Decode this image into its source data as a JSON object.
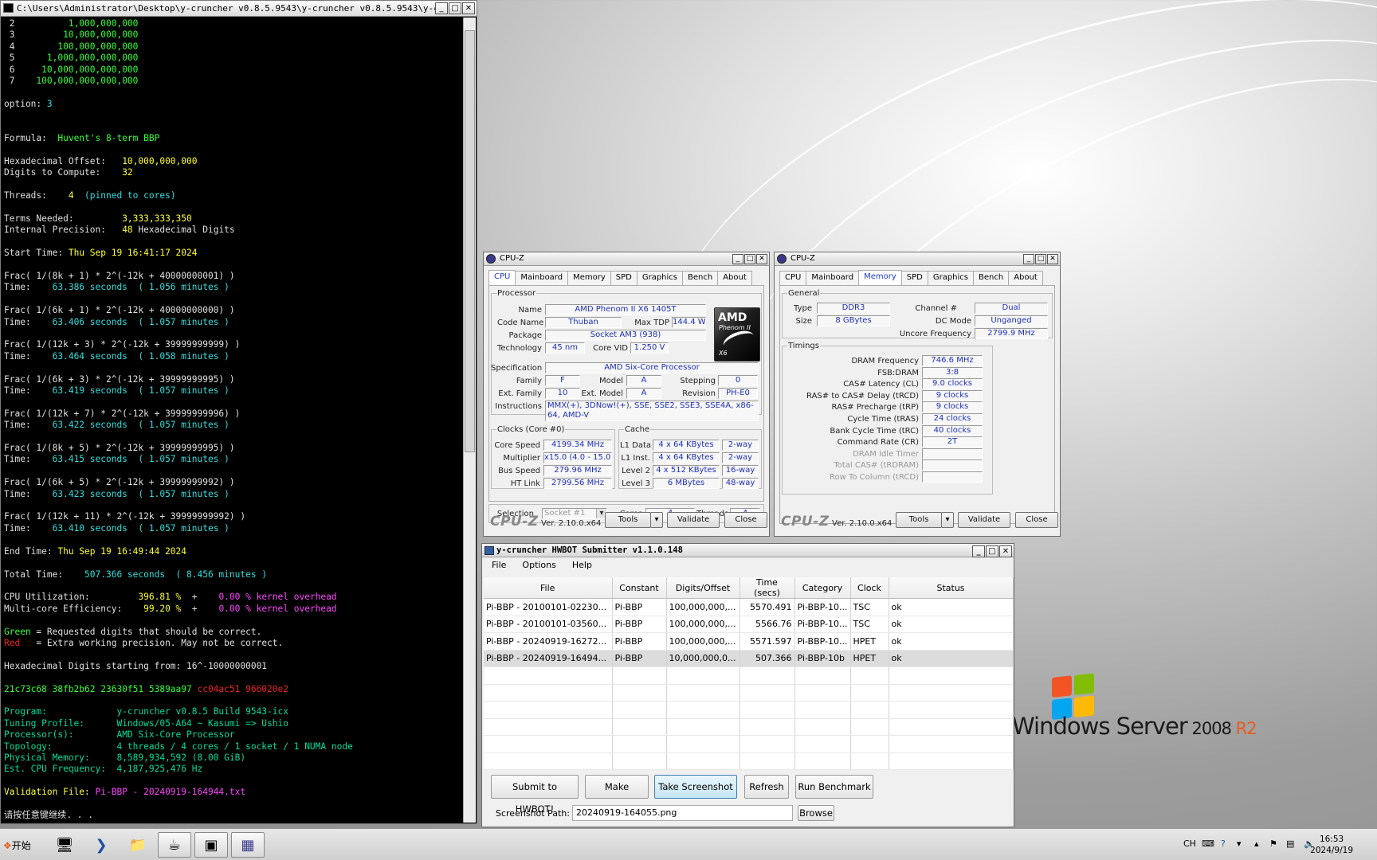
{
  "console": {
    "title": "C:\\Users\\Administrator\\Desktop\\y-cruncher v0.8.5.9543\\y-cruncher v0.8.5.9543\\y-c...",
    "options": [
      {
        "n": "2",
        "v": "1,000,000,000"
      },
      {
        "n": "3",
        "v": "10,000,000,000"
      },
      {
        "n": "4",
        "v": "100,000,000,000"
      },
      {
        "n": "5",
        "v": "1,000,000,000,000"
      },
      {
        "n": "6",
        "v": "10,000,000,000,000"
      },
      {
        "n": "7",
        "v": "100,000,000,000,000"
      }
    ],
    "option_label": "option: ",
    "option_value": "3",
    "formula_label": "Formula:  ",
    "formula_value": "Huvent's 8-term BBP",
    "hex_offset_label": "Hexadecimal Offset:   ",
    "hex_offset_value": "10,000,000,000",
    "digits_label": "Digits to Compute:    ",
    "digits_value": "32",
    "threads_label": "Threads:    ",
    "threads_value": "4",
    "threads_note": "  (pinned to cores)",
    "terms_label": "Terms Needed:         ",
    "terms_value": "3,333,333,350",
    "precision_label": "Internal Precision:   ",
    "precision_value": "48",
    "precision_unit": " Hexadecimal Digits",
    "start_label": "Start Time: ",
    "start_value": "Thu Sep 19 16:41:17 2024",
    "fracs": [
      {
        "f": "Frac( 1/(8k + 1) * 2^(-12k + 40000000001) )",
        "t": "63.386 seconds  ( 1.056 minutes )"
      },
      {
        "f": "Frac( 1/(6k + 1) * 2^(-12k + 40000000000) )",
        "t": "63.406 seconds  ( 1.057 minutes )"
      },
      {
        "f": "Frac( 1/(12k + 3) * 2^(-12k + 39999999999) )",
        "t": "63.464 seconds  ( 1.058 minutes )"
      },
      {
        "f": "Frac( 1/(6k + 3) * 2^(-12k + 39999999995) )",
        "t": "63.419 seconds  ( 1.057 minutes )"
      },
      {
        "f": "Frac( 1/(12k + 7) * 2^(-12k + 39999999996) )",
        "t": "63.422 seconds  ( 1.057 minutes )"
      },
      {
        "f": "Frac( 1/(8k + 5) * 2^(-12k + 39999999995) )",
        "t": "63.415 seconds  ( 1.057 minutes )"
      },
      {
        "f": "Frac( 1/(6k + 5) * 2^(-12k + 39999999992) )",
        "t": "63.423 seconds  ( 1.057 minutes )"
      },
      {
        "f": "Frac( 1/(12k + 11) * 2^(-12k + 39999999992) )",
        "t": "63.410 seconds  ( 1.057 minutes )"
      }
    ],
    "time_label": "Time:    ",
    "end_label": "End Time: ",
    "end_value": "Thu Sep 19 16:49:44 2024",
    "total_label": "Total Time:    ",
    "total_value": "507.366 seconds  ( 8.456 minutes )",
    "cpu_util_label": "CPU Utilization:         ",
    "cpu_util_value": "396.81 %",
    "cpu_util_kernel": "0.00 % kernel overhead",
    "multicore_label": "Multi-core Efficiency:    ",
    "multicore_value": "99.20 %",
    "multicore_kernel": "0.00 % kernel overhead",
    "plus": "  +    ",
    "legend_green": "Green",
    "legend_green_text": " = Requested digits that should be correct.",
    "legend_red": "Red",
    "legend_red_text": "   = Extra working precision. May not be correct.",
    "hex_start": "Hexadecimal Digits starting from: 16^-10000000001",
    "digits_green": "21c73c68 38fb2b62 23630f51 5389aa97",
    "digits_red": " cc04ac51 966020e2",
    "program_label": "Program:             ",
    "program_value": "y-cruncher v0.8.5 Build 9543-icx",
    "tuning_label": "Tuning Profile:      ",
    "tuning_value": "Windows/05-A64 ~ Kasumi => Ushio",
    "processor_label": "Processor(s):        ",
    "processor_value": "AMD Six-Core Processor",
    "topology_label": "Topology:            ",
    "topology_value": "4 threads / 4 cores / 1 socket / 1 NUMA node",
    "memory_label": "Physical Memory:     ",
    "memory_value": "8,589,934,592 (8.00 GiB)",
    "freq_label": "Est. CPU Frequency:  ",
    "freq_value": "4,187,925,476 Hz",
    "validation_label": "Validation File: ",
    "validation_value": "Pi-BBP - 20240919-164944.txt",
    "press_key": "请按任意键继续. . ."
  },
  "cpuz_cpu": {
    "title": "CPU-Z",
    "tabs": [
      "CPU",
      "Mainboard",
      "Memory",
      "SPD",
      "Graphics",
      "Bench",
      "About"
    ],
    "active_tab": "CPU",
    "processor_group": "Processor",
    "name_label": "Name",
    "name": "AMD Phenom II X6 1405T",
    "codename_label": "Code Name",
    "codename": "Thuban",
    "maxtdp_label": "Max TDP",
    "maxtdp": "144.4 W",
    "package_label": "Package",
    "package": "Socket AM3 (938)",
    "tech_label": "Technology",
    "tech": "45 nm",
    "corevid_label": "Core VID",
    "corevid": "1.250 V",
    "spec_label": "Specification",
    "spec": "AMD Six-Core Processor",
    "family_label": "Family",
    "family": "F",
    "model_label": "Model",
    "model": "A",
    "stepping_label": "Stepping",
    "stepping": "0",
    "extfamily_label": "Ext. Family",
    "extfamily": "10",
    "extmodel_label": "Ext. Model",
    "extmodel": "A",
    "revision_label": "Revision",
    "revision": "PH-E0",
    "instr_label": "Instructions",
    "instructions": "MMX(+), 3DNow!(+), SSE, SSE2, SSE3, SSE4A, x86-64, AMD-V",
    "logo_line1": "AMD",
    "logo_line2": "Phenom II",
    "logo_line3": "X6",
    "clocks_group": "Clocks (Core #0)",
    "corespeed_label": "Core Speed",
    "corespeed": "4199.34 MHz",
    "multiplier_label": "Multiplier",
    "multiplier": "x15.0 (4.0 - 15.0)",
    "busspeed_label": "Bus Speed",
    "busspeed": "279.96 MHz",
    "htlink_label": "HT Link",
    "htlink": "2799.56 MHz",
    "cache_group": "Cache",
    "l1d_label": "L1 Data",
    "l1d": "4 x 64 KBytes",
    "l1d_way": "2-way",
    "l1i_label": "L1 Inst.",
    "l1i": "4 x 64 KBytes",
    "l1i_way": "2-way",
    "l2_label": "Level 2",
    "l2": "4 x 512 KBytes",
    "l2_way": "16-way",
    "l3_label": "Level 3",
    "l3": "6 MBytes",
    "l3_way": "48-way",
    "selection_label": "Selection",
    "selection": "Socket #1",
    "cores_label": "Cores",
    "cores": "4",
    "threads_label": "Threads",
    "threads": "4",
    "brand": "CPU-Z",
    "version": "Ver. 2.10.0.x64",
    "tools": "Tools",
    "validate": "Validate",
    "close": "Close"
  },
  "cpuz_mem": {
    "title": "CPU-Z",
    "tabs": [
      "CPU",
      "Mainboard",
      "Memory",
      "SPD",
      "Graphics",
      "Bench",
      "About"
    ],
    "active_tab": "Memory",
    "general_group": "General",
    "type_label": "Type",
    "type": "DDR3",
    "channel_label": "Channel #",
    "channel": "Dual",
    "size_label": "Size",
    "size": "8 GBytes",
    "dcmode_label": "DC Mode",
    "dcmode": "Unganged",
    "uncore_label": "Uncore Frequency",
    "uncore": "2799.9 MHz",
    "timings_group": "Timings",
    "timings": [
      {
        "label": "DRAM Frequency",
        "value": "746.6 MHz",
        "dim": false
      },
      {
        "label": "FSB:DRAM",
        "value": "3:8",
        "dim": false
      },
      {
        "label": "CAS# Latency (CL)",
        "value": "9.0 clocks",
        "dim": false
      },
      {
        "label": "RAS# to CAS# Delay (tRCD)",
        "value": "9 clocks",
        "dim": false
      },
      {
        "label": "RAS# Precharge (tRP)",
        "value": "9 clocks",
        "dim": false
      },
      {
        "label": "Cycle Time (tRAS)",
        "value": "24 clocks",
        "dim": false
      },
      {
        "label": "Bank Cycle Time (tRC)",
        "value": "40 clocks",
        "dim": false
      },
      {
        "label": "Command Rate (CR)",
        "value": "2T",
        "dim": false
      },
      {
        "label": "DRAM Idle Timer",
        "value": "",
        "dim": true
      },
      {
        "label": "Total CAS# (tRDRAM)",
        "value": "",
        "dim": true
      },
      {
        "label": "Row To Column (tRCD)",
        "value": "",
        "dim": true
      }
    ],
    "brand": "CPU-Z",
    "version": "Ver. 2.10.0.x64",
    "tools": "Tools",
    "validate": "Validate",
    "close": "Close"
  },
  "hwbot": {
    "title": "y-cruncher HWBOT Submitter v1.1.0.148",
    "menu": [
      "File",
      "Options",
      "Help"
    ],
    "columns": [
      "File",
      "Constant",
      "Digits/Offset",
      "Time (secs)",
      "Category",
      "Clock",
      "Status"
    ],
    "rows": [
      [
        "Pi-BBP - 20100101-02230...",
        "Pi-BBP",
        "100,000,000,...",
        "5570.491",
        "Pi-BBP-10...",
        "TSC",
        "ok"
      ],
      [
        "Pi-BBP - 20100101-03560...",
        "Pi-BBP",
        "100,000,000,...",
        "5566.76",
        "Pi-BBP-10...",
        "TSC",
        "ok"
      ],
      [
        "Pi-BBP - 20240919-16272...",
        "Pi-BBP",
        "100,000,000,...",
        "5571.597",
        "Pi-BBP-10...",
        "HPET",
        "ok"
      ],
      [
        "Pi-BBP - 20240919-16494...",
        "Pi-BBP",
        "10,000,000,0...",
        "507.366",
        "Pi-BBP-10b",
        "HPET",
        "ok"
      ]
    ],
    "submit": "Submit to HWBOT!",
    "make_datafile": "Make Datafile",
    "take_screenshot": "Take Screenshot",
    "refresh": "Refresh",
    "run_benchmark": "Run Benchmark",
    "path_label": "Screenshot Path:",
    "path_value": "20240919-164055.png",
    "browse": "Browse"
  },
  "desktop": {
    "logo_text": "Windows Server",
    "logo_year": "2008",
    "logo_r2": "R2"
  },
  "taskbar": {
    "start": "开始",
    "lang": "CH",
    "time": "16:53",
    "date": "2024/9/19"
  }
}
